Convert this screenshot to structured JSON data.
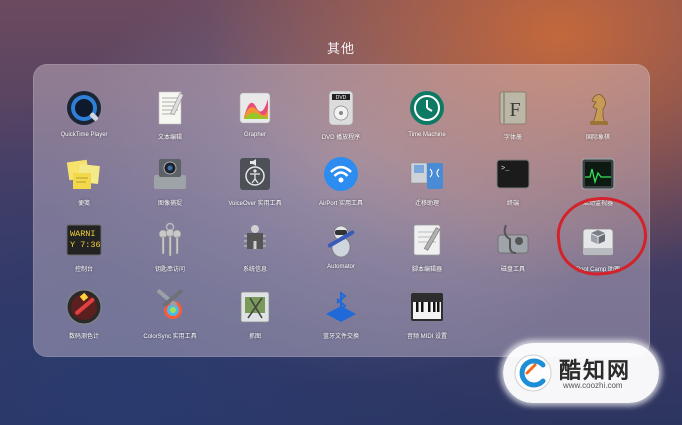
{
  "folder": {
    "title": "其他"
  },
  "apps": [
    {
      "label": "QuickTime Player",
      "icon": "quicktime-icon"
    },
    {
      "label": "文本编辑",
      "icon": "textedit-icon"
    },
    {
      "label": "Grapher",
      "icon": "grapher-icon"
    },
    {
      "label": "DVD 播放程序",
      "icon": "dvd-player-icon"
    },
    {
      "label": "Time Machine",
      "icon": "time-machine-icon"
    },
    {
      "label": "字体册",
      "icon": "font-book-icon"
    },
    {
      "label": "国际象棋",
      "icon": "chess-icon"
    },
    {
      "label": "便笺",
      "icon": "stickies-icon"
    },
    {
      "label": "图像捕捉",
      "icon": "image-capture-icon"
    },
    {
      "label": "VoiceOver 实用工具",
      "icon": "voiceover-icon"
    },
    {
      "label": "AirPort 实用工具",
      "icon": "airport-icon"
    },
    {
      "label": "迁移助理",
      "icon": "migration-assistant-icon"
    },
    {
      "label": "终端",
      "icon": "terminal-icon"
    },
    {
      "label": "活动监视器",
      "icon": "activity-monitor-icon"
    },
    {
      "label": "控制台",
      "icon": "console-icon"
    },
    {
      "label": "钥匙串访问",
      "icon": "keychain-icon"
    },
    {
      "label": "系统信息",
      "icon": "system-information-icon"
    },
    {
      "label": "Automator",
      "icon": "automator-icon"
    },
    {
      "label": "脚本编辑器",
      "icon": "script-editor-icon"
    },
    {
      "label": "磁盘工具",
      "icon": "disk-utility-icon"
    },
    {
      "label": "Boot Camp 助理",
      "icon": "boot-camp-icon"
    },
    {
      "label": "数码测色计",
      "icon": "digital-color-meter-icon"
    },
    {
      "label": "ColorSync 实用工具",
      "icon": "colorsync-icon"
    },
    {
      "label": "抓图",
      "icon": "grab-icon"
    },
    {
      "label": "蓝牙文件交换",
      "icon": "bluetooth-file-exchange-icon"
    },
    {
      "label": "音频 MIDI 设置",
      "icon": "audio-midi-icon"
    }
  ],
  "console_icon_text": [
    "WARNI",
    "Y 7:36"
  ],
  "terminal_icon_text": ">_",
  "font_book_icon_text": "F",
  "dvd_icon_text": "DVD",
  "annotation": {
    "color": "#d4222a"
  },
  "watermark": {
    "title": "酷知网",
    "url": "www.coozhi.com"
  }
}
